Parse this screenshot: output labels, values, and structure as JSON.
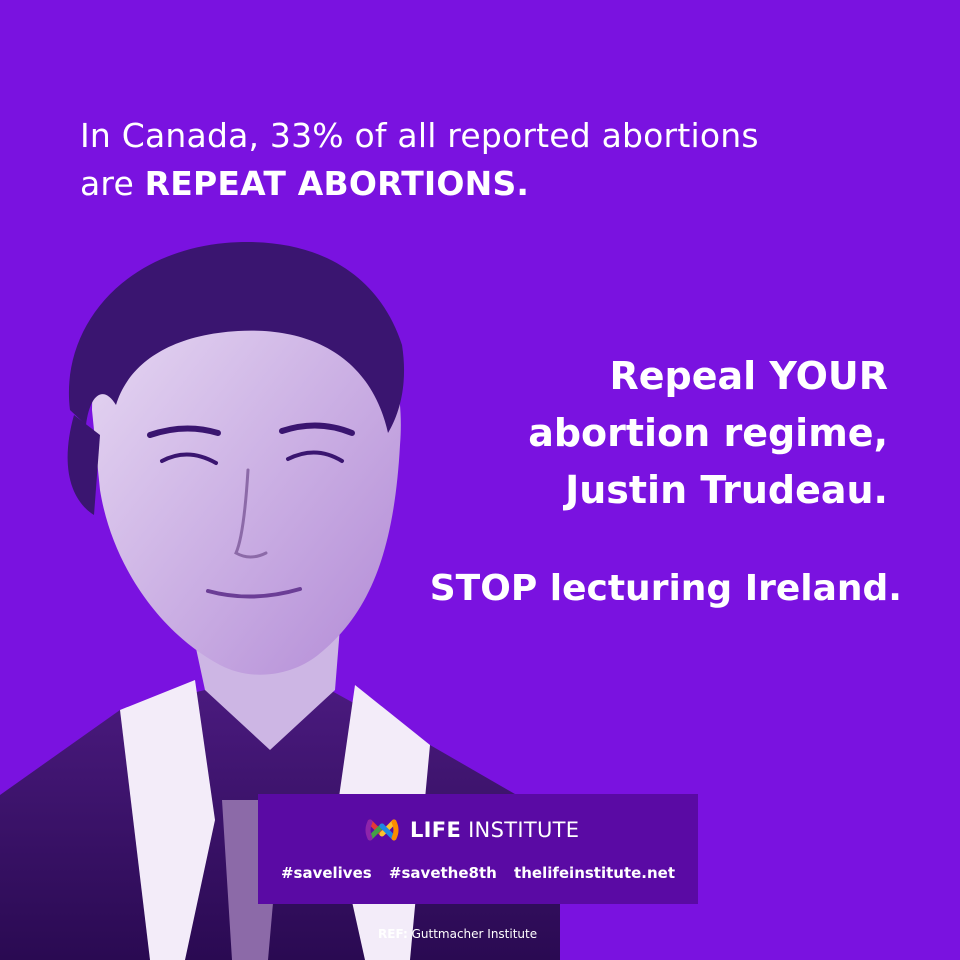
{
  "headline": {
    "line1": "In Canada, 33% of all reported abortions",
    "line2_prefix": "are ",
    "line2_bold": "REPEAT ABORTIONS."
  },
  "message": {
    "line1_prefix": "Repeal ",
    "line1_bold": "YOUR",
    "line2": "abortion regime,",
    "line3": "Justin Trudeau."
  },
  "stop": "STOP lecturing Ireland.",
  "badge": {
    "brand_bold": "LIFE",
    "brand_rest": " INSTITUTE",
    "tags": [
      "#savelives",
      "#savethe8th",
      "thelifeinstitute.net"
    ]
  },
  "reference": {
    "label": "REF:",
    "source": " Guttmacher Institute"
  },
  "colors": {
    "background": "#7a12e0",
    "badge": "#5a0aa4",
    "text": "#ffffff",
    "logo": [
      "#e53935",
      "#fbc02d",
      "#43a047",
      "#1e88e5"
    ]
  }
}
